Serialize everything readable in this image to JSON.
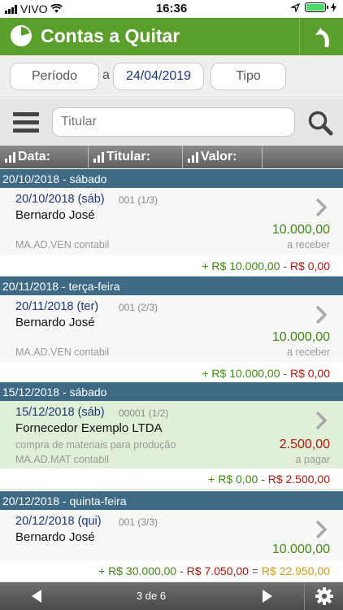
{
  "status_bar": {
    "carrier": "VIVO",
    "time": "16:36"
  },
  "header": {
    "title": "Contas a Quitar"
  },
  "filters": {
    "period_label": "Período",
    "separator": "a",
    "date": "24/04/2019",
    "type_label": "Tipo"
  },
  "search": {
    "placeholder": "Titular"
  },
  "columns": [
    {
      "label": "Data:"
    },
    {
      "label": "Titular:"
    },
    {
      "label": "Valor:"
    }
  ],
  "groups": [
    {
      "header": "20/10/2018 -  sábado",
      "entry": {
        "date": "20/10/2018 (sáb)",
        "doc": "001 (1/3)",
        "name": "Bernardo José",
        "description": "",
        "amount": "10.000,00",
        "account": "MA.AD.VEN contabil",
        "status": "a receber"
      },
      "totals": {
        "plus": "+ R$ 10.000,00",
        "sep": " - ",
        "minus": "R$ 0,00"
      }
    },
    {
      "header": "20/11/2018 -  terça-feira",
      "entry": {
        "date": "20/11/2018 (ter)",
        "doc": "001 (2/3)",
        "name": "Bernardo José",
        "description": "",
        "amount": "10.000,00",
        "account": "MA.AD.VEN contabil",
        "status": "a receber"
      },
      "totals": {
        "plus": "+ R$ 10.000,00",
        "sep": " - ",
        "minus": "R$ 0,00"
      }
    },
    {
      "header": "15/12/2018 -  sábado",
      "entry": {
        "date": "15/12/2018 (sáb)",
        "doc": "00001 (1/2)",
        "name": "Fornecedor Exemplo LTDA",
        "description": "compra de materiais para produção",
        "amount": "2.500,00",
        "account": "MA.AD.MAT contabil",
        "status": "a pagar"
      },
      "totals": {
        "plus": "+ R$ 0,00",
        "sep": " - ",
        "minus": "R$ 2.500,00"
      }
    },
    {
      "header": "20/12/2018 -  quinta-feira",
      "entry": {
        "date": "20/12/2018 (qui)",
        "doc": "001 (3/3)",
        "name": "Bernardo José",
        "description": "",
        "amount": "10.000,00",
        "account": "",
        "status": ""
      }
    }
  ],
  "summary": {
    "plus": "+ R$ 30.000,00",
    "sep1": " - ",
    "minus": "R$ 7.050,00",
    "sep2": " = ",
    "result": "R$ 22.950,00"
  },
  "pager": {
    "text": "3 de 6"
  },
  "colors": {
    "header_green": "#5a9e2c",
    "group_blue": "#3e6a86",
    "positive": "#3f8a12",
    "negative": "#b3140c",
    "balance": "#d49a10"
  }
}
